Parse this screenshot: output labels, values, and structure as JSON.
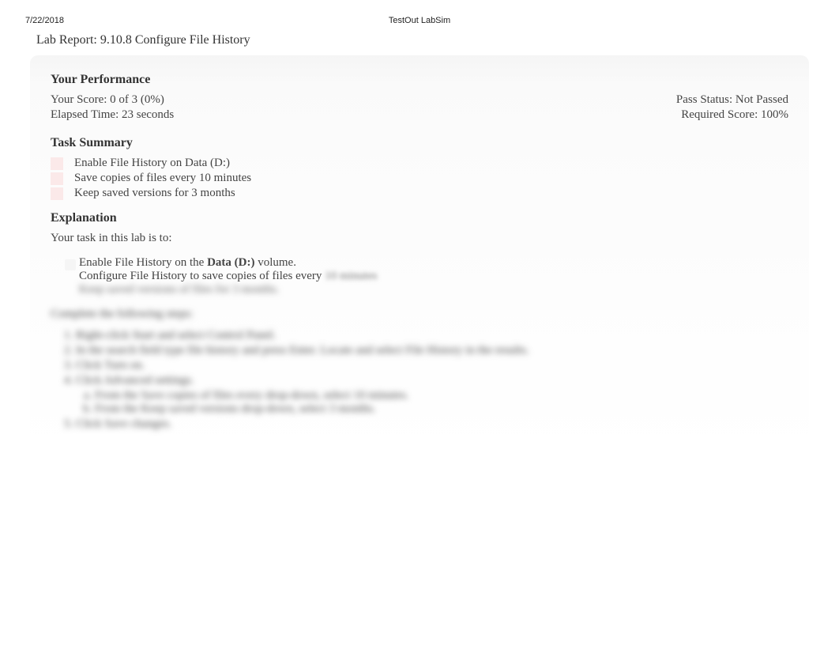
{
  "header": {
    "date": "7/22/2018",
    "center": "TestOut LabSim"
  },
  "lab_title": "Lab Report: 9.10.8 Configure File History",
  "performance": {
    "heading": "Your Performance",
    "score": "Your Score: 0 of 3 (0%)",
    "pass": "Pass Status: Not Passed",
    "elapsed": "Elapsed Time: 23 seconds",
    "required": "Required Score: 100%"
  },
  "task_summary": {
    "heading": "Task Summary",
    "items": [
      "Enable File History on Data (D:)",
      "Save copies of files every 10 minutes",
      "Keep saved versions for 3 months"
    ]
  },
  "explanation": {
    "heading": "Explanation",
    "intro": "Your task in this lab is to:",
    "bullets": {
      "line1_part1": "Enable File History on the ",
      "line1_bold": "Data (D:)",
      "line1_part2": " volume.",
      "line2_part1": "Configure File History to save copies of files every ",
      "line2_blur": "10 minutes",
      "line3_blur": "Keep saved versions of files for 3 months."
    },
    "steps_heading": "Complete the following steps:",
    "steps": [
      {
        "text": "Right-click Start and select Control Panel.",
        "subs": []
      },
      {
        "text": "In the search field type file history and press Enter. Locate and select File History in the results.",
        "subs": []
      },
      {
        "text": "Click Turn on.",
        "subs": []
      },
      {
        "text": "Click Advanced settings.",
        "subs": [
          "From the Save copies of files every drop-down, select 10 minutes.",
          "From the Keep saved versions drop-down, select 3 months."
        ]
      },
      {
        "text": "Click Save changes.",
        "subs": []
      }
    ]
  }
}
